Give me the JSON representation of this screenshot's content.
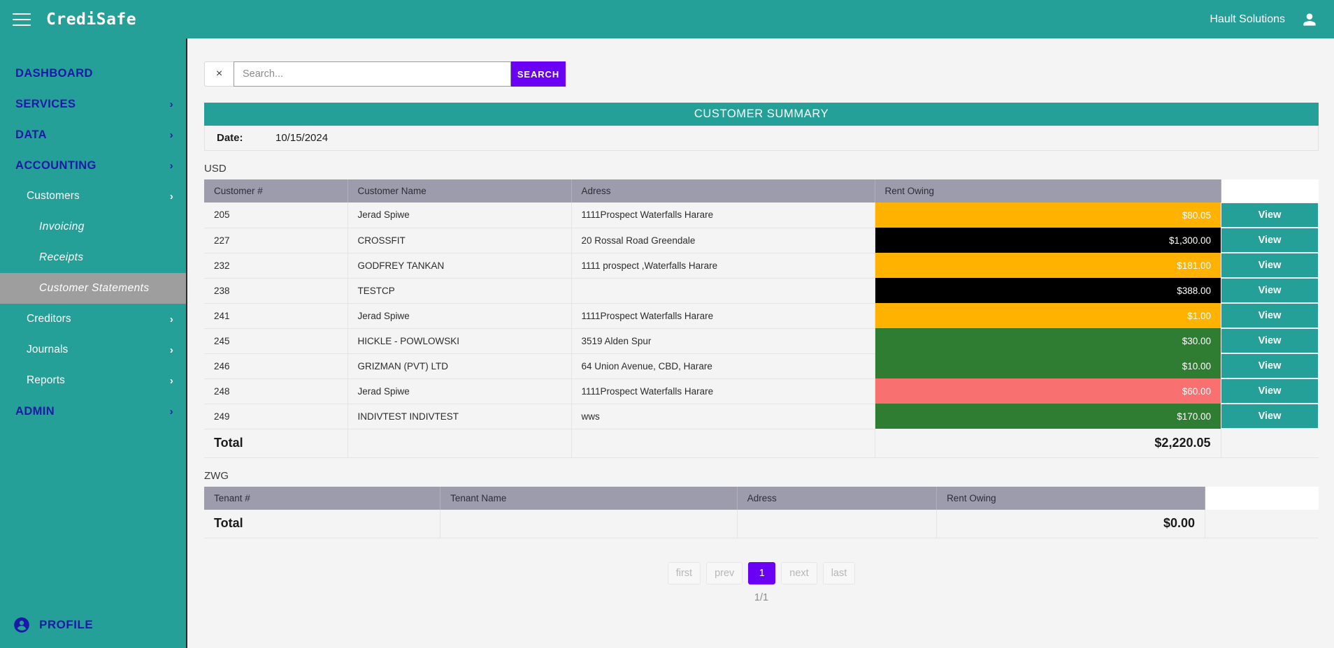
{
  "topbar": {
    "brand": "CrediSafe",
    "org_name": "Hault Solutions",
    "menu_icon": "hamburger-menu-icon",
    "avatar_icon": "account-circle-icon"
  },
  "sidebar": {
    "items": [
      {
        "label": "DASHBOARD",
        "level": 1,
        "chevron": "",
        "active": false
      },
      {
        "label": "SERVICES",
        "level": 1,
        "chevron": "›",
        "active": false
      },
      {
        "label": "DATA",
        "level": 1,
        "chevron": "›",
        "active": false
      },
      {
        "label": "ACCOUNTING",
        "level": 1,
        "chevron": "›",
        "active": false
      },
      {
        "label": "Customers",
        "level": 2,
        "chevron": "›",
        "active": false
      },
      {
        "label": "Invoicing",
        "level": 3,
        "chevron": "",
        "active": false
      },
      {
        "label": "Receipts",
        "level": 3,
        "chevron": "",
        "active": false
      },
      {
        "label": "Customer Statements",
        "level": 3,
        "chevron": "",
        "active": true
      },
      {
        "label": "Creditors",
        "level": 2,
        "chevron": "›",
        "active": false
      },
      {
        "label": "Journals",
        "level": 2,
        "chevron": "›",
        "active": false
      },
      {
        "label": "Reports",
        "level": 2,
        "chevron": "›",
        "active": false
      },
      {
        "label": "ADMIN",
        "level": 1,
        "chevron": "›",
        "active": false
      }
    ],
    "profile": {
      "label": "PROFILE",
      "icon": "account-circle-icon"
    }
  },
  "search": {
    "clear_label": "×",
    "placeholder": "Search...",
    "value": "",
    "button_label": "SEARCH"
  },
  "summary": {
    "title": "CUSTOMER SUMMARY",
    "date_label": "Date:",
    "date_value": "10/15/2024"
  },
  "usd_table": {
    "currency": "USD",
    "columns": [
      "Customer #",
      "Customer Name",
      "Adress",
      "Rent Owing",
      ""
    ],
    "rows": [
      {
        "id": "205",
        "name": "Jerad Spiwe",
        "address": "1111Prospect Waterfalls Harare",
        "amount": "$80.05",
        "color": "#FFB300",
        "action": "View"
      },
      {
        "id": "227",
        "name": "CROSSFIT",
        "address": "20 Rossal Road Greendale",
        "amount": "$1,300.00",
        "color": "#000000",
        "action": "View"
      },
      {
        "id": "232",
        "name": "GODFREY TANKAN",
        "address": "1111 prospect ,Waterfalls Harare",
        "amount": "$181.00",
        "color": "#FFB300",
        "action": "View"
      },
      {
        "id": "238",
        "name": "TESTCP",
        "address": "",
        "amount": "$388.00",
        "color": "#000000",
        "action": "View"
      },
      {
        "id": "241",
        "name": "Jerad Spiwe",
        "address": "1111Prospect Waterfalls Harare",
        "amount": "$1.00",
        "color": "#FFB300",
        "action": "View"
      },
      {
        "id": "245",
        "name": "HICKLE - POWLOWSKI",
        "address": "3519 Alden Spur",
        "amount": "$30.00",
        "color": "#2E7D32",
        "action": "View"
      },
      {
        "id": "246",
        "name": "GRIZMAN (PVT) LTD",
        "address": "64 Union Avenue, CBD, Harare",
        "amount": "$10.00",
        "color": "#2E7D32",
        "action": "View"
      },
      {
        "id": "248",
        "name": "Jerad Spiwe",
        "address": "1111Prospect Waterfalls Harare",
        "amount": "$60.00",
        "color": "#F97070",
        "action": "View"
      },
      {
        "id": "249",
        "name": "INDIVTEST INDIVTEST",
        "address": "wws",
        "amount": "$170.00",
        "color": "#2E7D32",
        "action": "View"
      }
    ],
    "total_label": "Total",
    "total_amount": "$2,220.05"
  },
  "zwg_table": {
    "currency": "ZWG",
    "columns": [
      "Tenant #",
      "Tenant Name",
      "Adress",
      "Rent Owing",
      ""
    ],
    "rows": [],
    "total_label": "Total",
    "total_amount": "$0.00"
  },
  "pagination": {
    "first": "first",
    "prev": "prev",
    "current": "1",
    "next": "next",
    "last": "last",
    "page_count": "1/1"
  },
  "colors": {
    "brand_teal": "#25a099",
    "accent_purple": "#6a00f4",
    "nav_blue": "#1a1aa8",
    "header_gray": "#9d9cac",
    "active_gray": "#9e9e9e"
  }
}
